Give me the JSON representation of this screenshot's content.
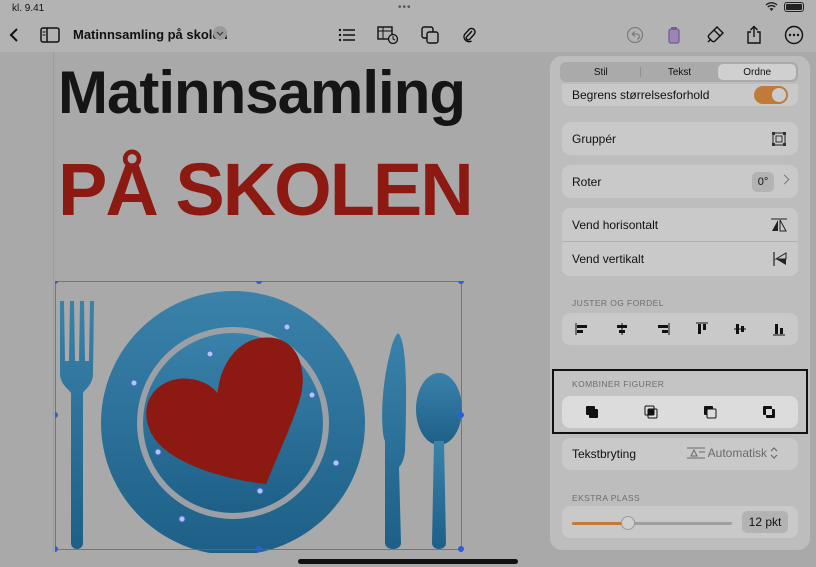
{
  "status": {
    "time": "kl. 9.41",
    "battery_icon": "battery-icon",
    "wifi_icon": "wifi-icon"
  },
  "toolbar": {
    "doc_title": "Matinnsamling på skolen"
  },
  "document": {
    "headline_line1": "Matinnsamling",
    "headline_line2": "PÅ SKOLEN",
    "colors": {
      "headline_red": "#8c1a12",
      "plate_blue": "#2a6e96",
      "heart_red": "#8c1a12"
    }
  },
  "panel": {
    "tabs": [
      {
        "label": "Stil"
      },
      {
        "label": "Tekst"
      },
      {
        "label": "Ordne"
      }
    ],
    "active_tab": "Ordne",
    "aspect_ratio_label": "Begrens størrelsesforhold",
    "aspect_ratio_on": true,
    "group_label": "Gruppér",
    "rotate_label": "Roter",
    "rotate_value": "0°",
    "flip_h_label": "Vend horisontalt",
    "flip_v_label": "Vend vertikalt",
    "align_section": "JUSTER OG FORDEL",
    "combine_section": "KOMBINER FIGURER",
    "wrap_label": "Tekstbryting",
    "wrap_value": "Automatisk",
    "extra_space_section": "EKSTRA PLASS",
    "extra_space_value": "12 pkt",
    "extra_space_slider_fraction": 0.35,
    "accent_color": "#c07b3a"
  }
}
